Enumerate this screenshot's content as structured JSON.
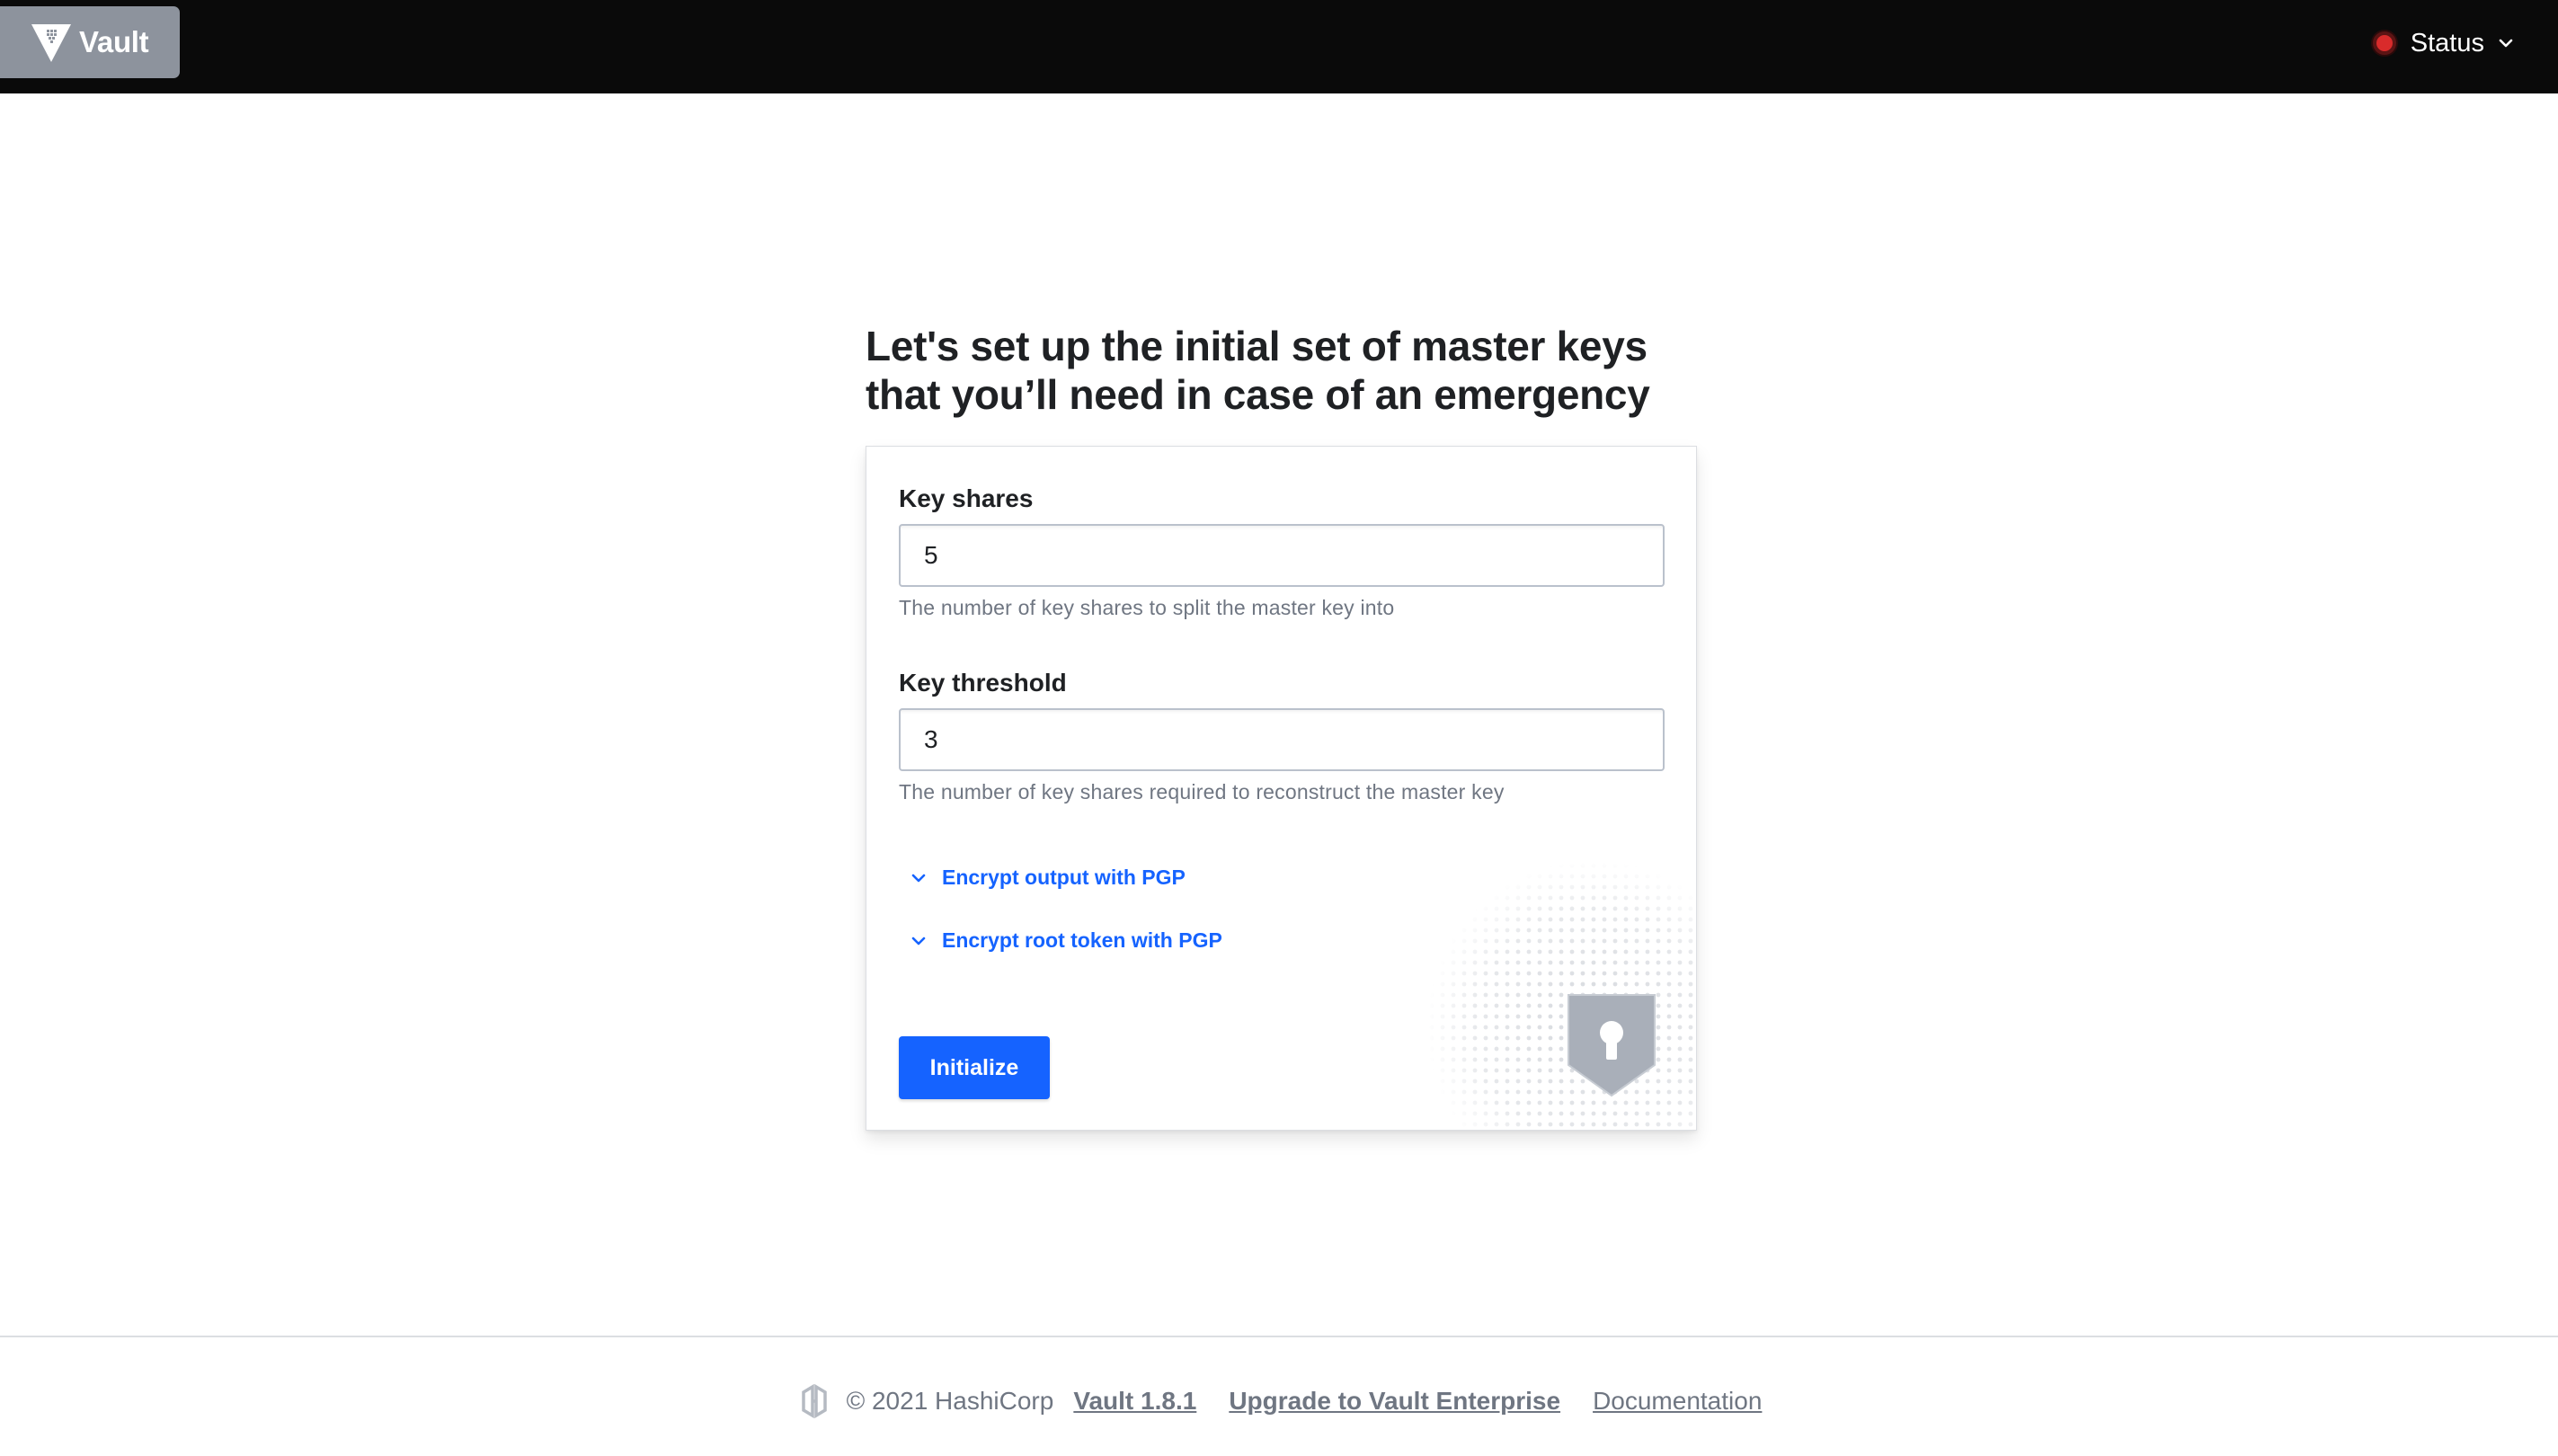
{
  "navbar": {
    "brand_label": "Vault",
    "status_label": "Status",
    "status_color": "#d92b2b"
  },
  "main": {
    "title_line1": "Let's set up the initial set of master keys",
    "title_line2": "that you’ll need in case of an emergency",
    "key_shares": {
      "label": "Key shares",
      "value": "5",
      "help": "The number of key shares to split the master key into"
    },
    "key_threshold": {
      "label": "Key threshold",
      "value": "3",
      "help": "The number of key shares required to reconstruct the master key"
    },
    "toggles": [
      {
        "label": "Encrypt output with PGP"
      },
      {
        "label": "Encrypt root token with PGP"
      }
    ],
    "submit_label": "Initialize",
    "accent_color": "#1563ff"
  },
  "footer": {
    "copyright": "© 2021 HashiCorp",
    "version_link": "Vault 1.8.1",
    "upgrade_link": "Upgrade to Vault Enterprise",
    "docs_link": "Documentation"
  },
  "icons": {
    "brand": "vault-logo-icon",
    "status": "status-dot-icon",
    "chevron": "chevron-down-icon",
    "footer": "hashicorp-logo-icon",
    "decoration": "shield-keyhole-icon"
  }
}
